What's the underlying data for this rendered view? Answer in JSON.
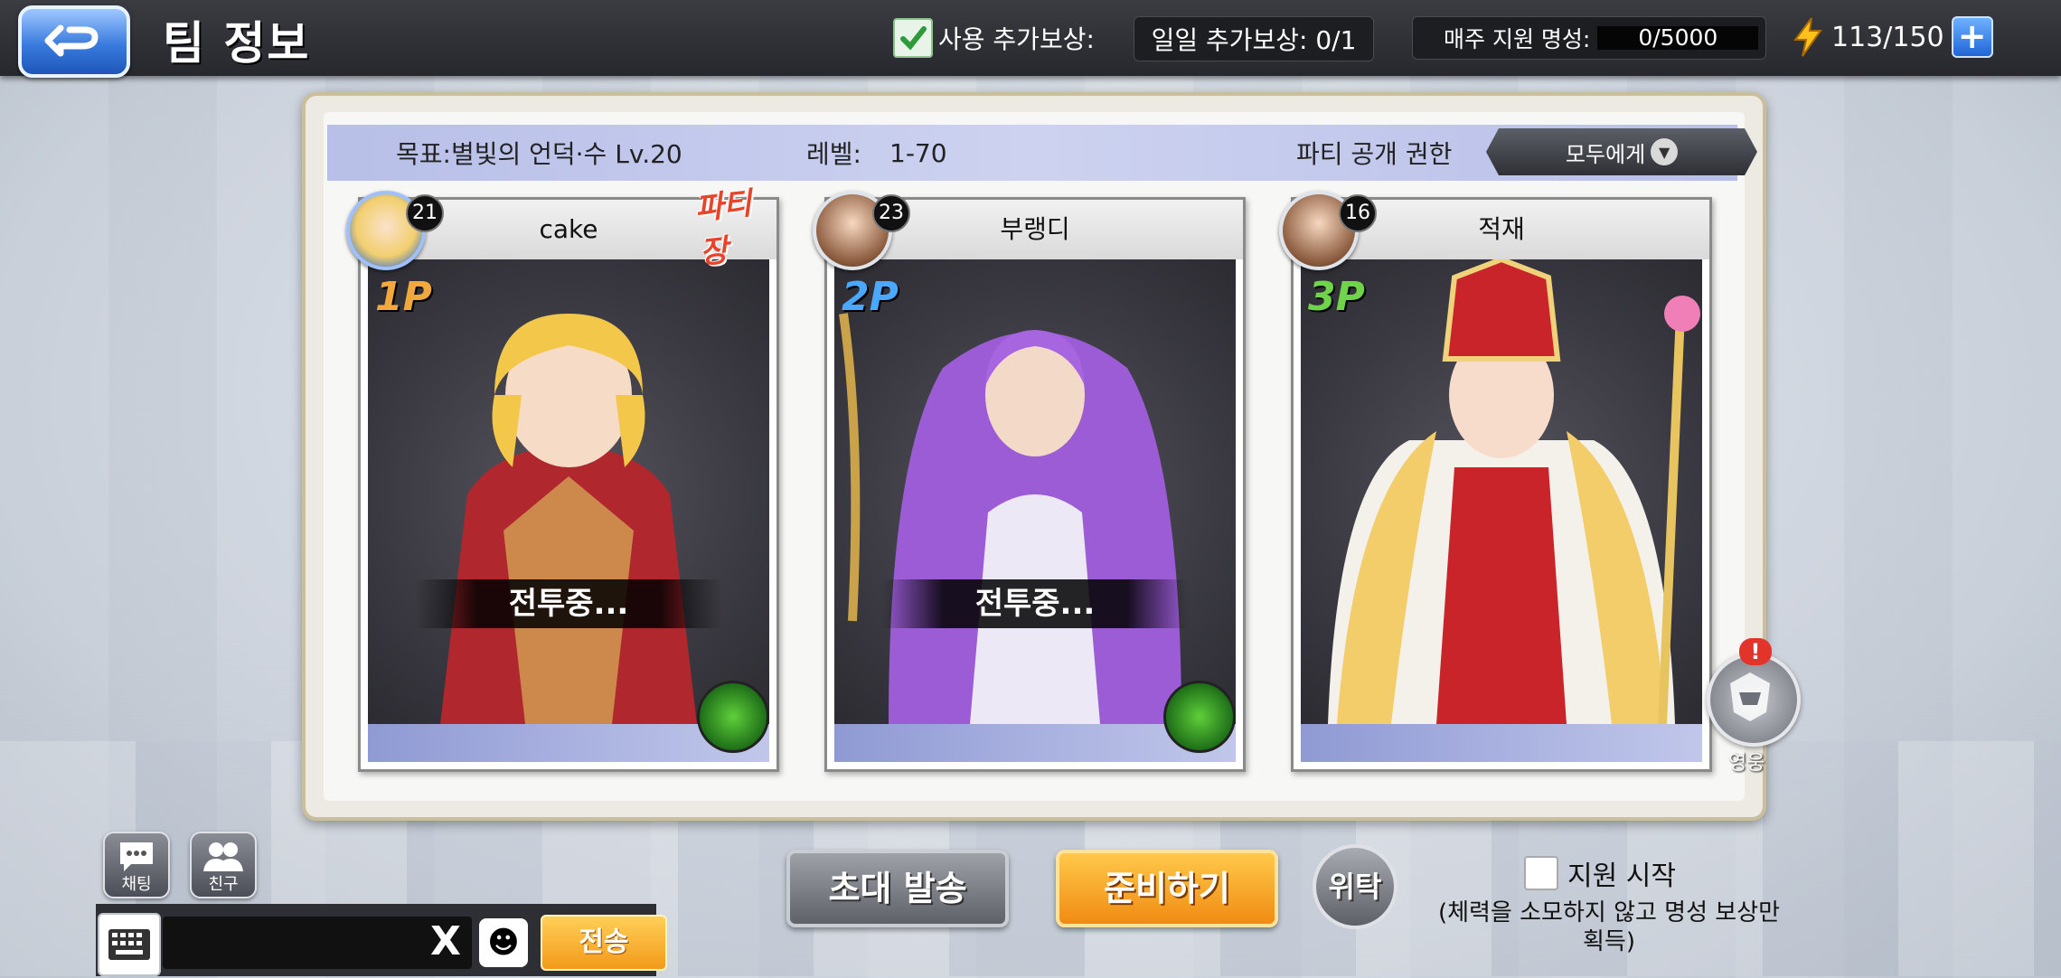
{
  "header": {
    "title": "팀 정보",
    "use_reward_label": "사용 추가보상:",
    "daily_reward": "일일 추가보상: 0/1",
    "weekly_label": "매주 지원 명성:",
    "weekly_value": "0/5000",
    "stamina": "113/150"
  },
  "info": {
    "goal": "목표:별빛의 언덕·수 Lv.20",
    "level_label": "레벨:",
    "level_value": "1-70",
    "visibility_label": "파티 공개 권한",
    "visibility_value": "모두에게"
  },
  "members": [
    {
      "name": "cake",
      "level": "21",
      "slot": "1P",
      "status": "전투중...",
      "leader": "파티장"
    },
    {
      "name": "부랭디",
      "level": "23",
      "slot": "2P",
      "status": "전투중..."
    },
    {
      "name": "적재",
      "level": "16",
      "slot": "3P"
    }
  ],
  "side": {
    "hero_label": "영웅",
    "hero_alert": "!"
  },
  "bottom": {
    "chat_label": "채팅",
    "friend_label": "친구",
    "send_label": "전송",
    "clear_glyph": "X",
    "invite_label": "초대 발송",
    "ready_label": "준비하기",
    "delegate_label": "위탁",
    "support_label": "지원 시작",
    "support_note": "(체력을 소모하지 않고 명성 보상만 획득)"
  },
  "colors": {
    "accent_orange": "#f39a1a",
    "accent_blue": "#3a7bdf",
    "info_bar": "#c3c9ee"
  }
}
